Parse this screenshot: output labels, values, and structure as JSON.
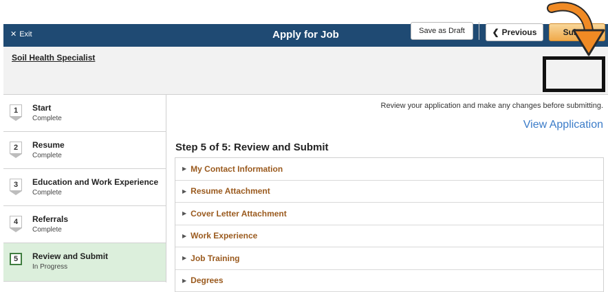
{
  "header": {
    "exit_label": "Exit",
    "title": "Apply for Job"
  },
  "job": {
    "title": "Soil Health Specialist"
  },
  "toolbar": {
    "save_draft": "Save as Draft",
    "previous": "Previous",
    "submit": "Submit"
  },
  "steps": [
    {
      "num": "1",
      "name": "Start",
      "status": "Complete"
    },
    {
      "num": "2",
      "name": "Resume",
      "status": "Complete"
    },
    {
      "num": "3",
      "name": "Education and Work Experience",
      "status": "Complete"
    },
    {
      "num": "4",
      "name": "Referrals",
      "status": "Complete"
    },
    {
      "num": "5",
      "name": "Review and Submit",
      "status": "In Progress"
    }
  ],
  "main": {
    "review_note": "Review your application and make any changes before submitting.",
    "view_application": "View Application",
    "step_heading": "Step 5 of 5: Review and Submit",
    "sections": [
      "My Contact Information",
      "Resume Attachment",
      "Cover Letter Attachment",
      "Work Experience",
      "Job Training",
      "Degrees"
    ]
  },
  "colors": {
    "header_bg": "#1f4a73",
    "submit_bg": "#f0a94a",
    "active_step_bg": "#dcefdc",
    "section_label": "#9a5a1e",
    "link": "#3a7bc8",
    "arrow": "#f08a24"
  }
}
